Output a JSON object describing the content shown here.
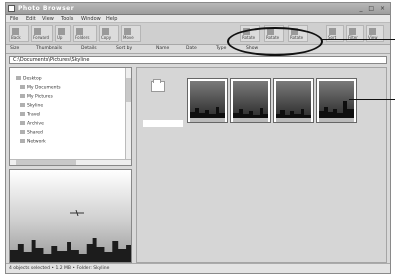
{
  "window": {
    "title": "Photo Browser",
    "controls": "_ □ ×"
  },
  "menu": {
    "items": [
      "File",
      "Edit",
      "View",
      "Tools",
      "Window",
      "Help"
    ]
  },
  "toolbar": {
    "buttons": [
      "Back",
      "Forward",
      "Up",
      "Folders",
      "Copy",
      "Move",
      "Rotate",
      "Rotate",
      "Rotate",
      "Sort",
      "Filter",
      "View"
    ]
  },
  "toolbar2": {
    "items": [
      "Size",
      "Thumbnails",
      "Details",
      "Sort by",
      "Name",
      "Date",
      "Type",
      "Show"
    ]
  },
  "address": {
    "path": "C:\\Documents\\Pictures\\Skyline"
  },
  "tree": {
    "items": [
      "Desktop",
      "My Documents",
      "My Pictures",
      "Skyline",
      "Travel",
      "Archive",
      "Shared",
      "Network"
    ]
  },
  "status": {
    "text": "4 objects selected • 1.2 MB • Folder: Skyline"
  },
  "colors": {
    "window_bg": "#d9d9d9",
    "content_bg": "#d6d6d6",
    "thumb_border": "#666666",
    "callout": "#111111"
  },
  "icons": {
    "folder": "folder-icon",
    "app": "app-icon"
  }
}
